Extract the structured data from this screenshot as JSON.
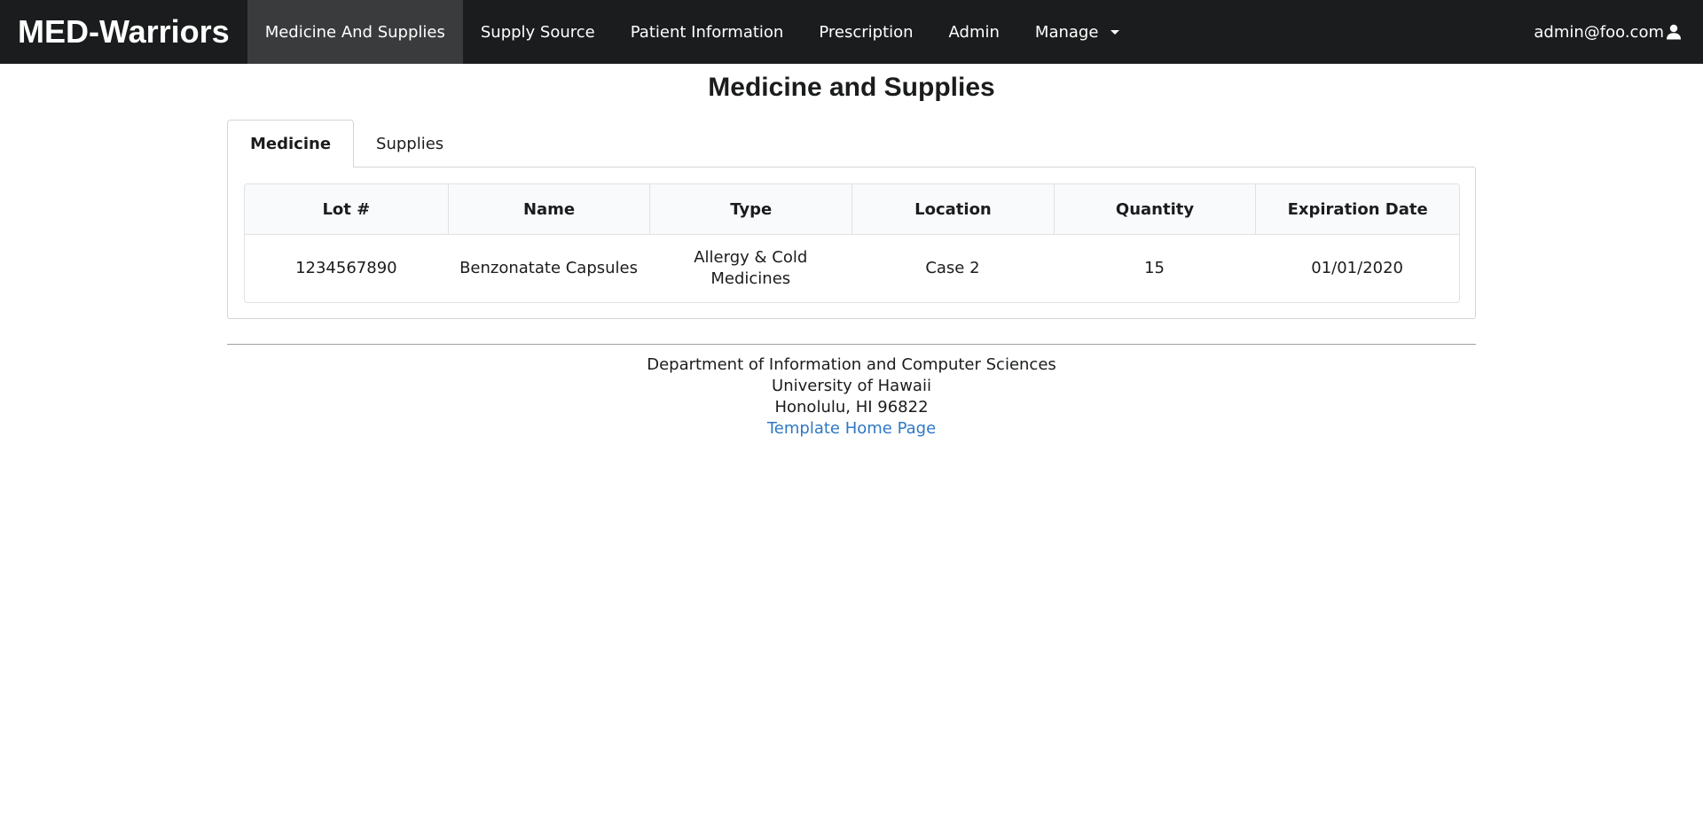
{
  "navbar": {
    "brand": "MED-Warriors",
    "items": [
      {
        "label": "Medicine And Supplies",
        "active": true
      },
      {
        "label": "Supply Source"
      },
      {
        "label": "Patient Information"
      },
      {
        "label": "Prescription"
      },
      {
        "label": "Admin"
      },
      {
        "label": "Manage",
        "dropdown": true
      }
    ],
    "user": "admin@foo.com",
    "user_icon": "user-icon"
  },
  "page": {
    "title": "Medicine and Supplies"
  },
  "tabs": [
    {
      "label": "Medicine",
      "active": true
    },
    {
      "label": "Supplies"
    }
  ],
  "table": {
    "headers": [
      "Lot #",
      "Name",
      "Type",
      "Location",
      "Quantity",
      "Expiration Date"
    ],
    "rows": [
      [
        "1234567890",
        "Benzonatate Capsules",
        "Allergy & Cold Medicines",
        "Case 2",
        "15",
        "01/01/2020"
      ]
    ]
  },
  "footer": {
    "line1": "Department of Information and Computer Sciences",
    "line2": "University of Hawaii",
    "line3": "Honolulu, HI 96822",
    "link": "Template Home Page"
  },
  "colors": {
    "navbar_bg": "#1b1c1d",
    "nav_active_bg": "#3a3b3c",
    "link": "#2f78c4"
  }
}
